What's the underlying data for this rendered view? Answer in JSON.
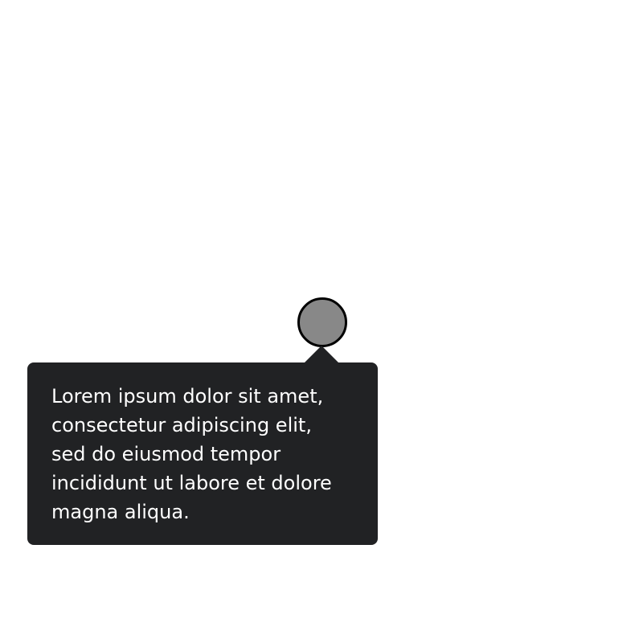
{
  "tooltip": {
    "lines": [
      "Lorem ipsum dolor sit amet,",
      "consectetur adipiscing elit,",
      "sed do eiusmod tempor",
      "incididunt ut labore et dolore",
      "magna aliqua."
    ],
    "background_color": "#212224",
    "text_color": "#ffffff"
  },
  "anchor": {
    "fill_color": "#888888",
    "border_color": "#000000"
  }
}
